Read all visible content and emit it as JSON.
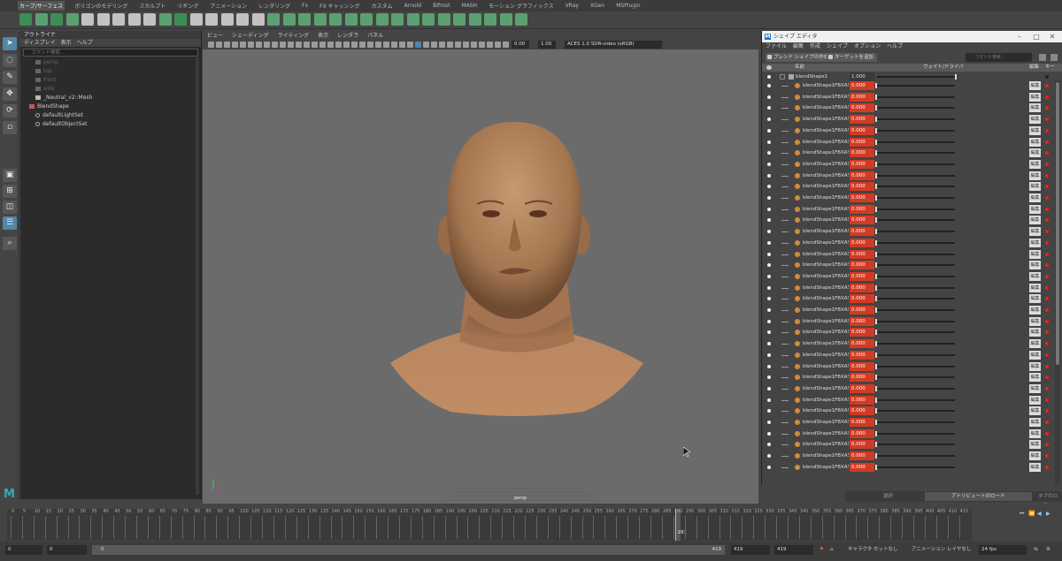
{
  "shelf": {
    "tabs": [
      "カーブ/サーフェス",
      "ポリゴンのモデリング",
      "スカルプト",
      "リギング",
      "アニメーション",
      "レンダリング",
      "Fx",
      "FX キャッシング",
      "カスタム",
      "Arnold",
      "Bifrost",
      "MASH",
      "モーション グラフィックス",
      "VRay",
      "XGen",
      "MSPlugin"
    ],
    "active_tab_index": 0
  },
  "outliner": {
    "title": "アウトライナ",
    "menu": [
      "ディスプレイ",
      "表示",
      "ヘルプ"
    ],
    "search_placeholder": "コマンド検索...",
    "items": [
      {
        "label": "persp",
        "dim": true,
        "icon": "camera-icon"
      },
      {
        "label": "top",
        "dim": true,
        "icon": "camera-icon"
      },
      {
        "label": "front",
        "dim": true,
        "icon": "camera-icon"
      },
      {
        "label": "side",
        "dim": true,
        "icon": "camera-icon"
      },
      {
        "label": "_Neutral_v2::Mesh",
        "dim": false,
        "icon": "mesh-icon"
      },
      {
        "label": "BlendShape",
        "dim": false,
        "icon": "blendshape-icon"
      },
      {
        "label": "defaultLightSet",
        "dim": false,
        "icon": "set-icon"
      },
      {
        "label": "defaultObjectSet",
        "dim": false,
        "icon": "set-icon"
      }
    ]
  },
  "viewport": {
    "menu": [
      "ビュー",
      "シェーディング",
      "ライティング",
      "表示",
      "レンダラ",
      "パネル"
    ],
    "field_a": "0.00",
    "field_b": "1.00",
    "color_space": "ACES 1.0 SDR-video (sRGB)",
    "camera_label": "persp"
  },
  "shape_editor": {
    "title": "シェイプ エディタ",
    "menu": [
      "ファイル",
      "編集",
      "作成",
      "シェイプ",
      "オプション",
      "ヘルプ"
    ],
    "btn_create_blend": "ブレンド シェイプの作成",
    "btn_add_target": "ターゲットを追加",
    "search_placeholder": "コマンド検索...",
    "col_name": "名前",
    "col_weight": "ウェイト/ドライバ",
    "col_edit": "編集",
    "col_key": "キー",
    "parent": {
      "name": "blendShape1",
      "value": "1.000"
    },
    "rows": [
      {
        "name": "blendShape1FBXASC",
        "value": "0.000"
      },
      {
        "name": "blendShape1FBXASC",
        "value": "0.000"
      },
      {
        "name": "blendShape1FBXASC",
        "value": "0.000"
      },
      {
        "name": "blendShape1FBXASC",
        "value": "0.000"
      },
      {
        "name": "blendShape1FBXASC",
        "value": "0.000"
      },
      {
        "name": "blendShape1FBXASC",
        "value": "0.000"
      },
      {
        "name": "blendShape1FBXASC",
        "value": "0.000"
      },
      {
        "name": "blendShape1FBXASC",
        "value": "0.000"
      },
      {
        "name": "blendShape1FBXASC",
        "value": "0.000"
      },
      {
        "name": "blendShape1FBXASC",
        "value": "0.000"
      },
      {
        "name": "blendShape1FBXASC",
        "value": "0.000"
      },
      {
        "name": "blendShape1FBXASC",
        "value": "0.000"
      },
      {
        "name": "blendShape1FBXASC",
        "value": "0.000"
      },
      {
        "name": "blendShape1FBXASC",
        "value": "0.000"
      },
      {
        "name": "blendShape1FBXASC",
        "value": "0.000"
      },
      {
        "name": "blendShape1FBXASC",
        "value": "0.000"
      },
      {
        "name": "blendShape1FBXASC",
        "value": "0.000"
      },
      {
        "name": "blendShape1FBXASC",
        "value": "0.000"
      },
      {
        "name": "blendShape1FBXASC",
        "value": "0.000"
      },
      {
        "name": "blendShape1FBXASC",
        "value": "0.000"
      },
      {
        "name": "blendShape1FBXASC",
        "value": "0.000"
      },
      {
        "name": "blendShape1FBXASC",
        "value": "0.000"
      },
      {
        "name": "blendShape1FBXASC",
        "value": "0.000"
      },
      {
        "name": "blendShape1FBXASC",
        "value": "0.000"
      },
      {
        "name": "blendShape1FBXASC",
        "value": "0.000"
      },
      {
        "name": "blendShape1FBXASC",
        "value": "0.000"
      },
      {
        "name": "blendShape1FBXASC",
        "value": "0.000"
      },
      {
        "name": "blendShape1FBXASC",
        "value": "0.000"
      },
      {
        "name": "blendShape1FBXASC",
        "value": "0.000"
      },
      {
        "name": "blendShape1FBXASC",
        "value": "0.000"
      },
      {
        "name": "blendShape1FBXASC",
        "value": "0.000"
      },
      {
        "name": "blendShape1FBXASC",
        "value": "0.000"
      },
      {
        "name": "blendShape1FBXASC",
        "value": "0.000"
      },
      {
        "name": "blendShape1FBXASC",
        "value": "0.000"
      },
      {
        "name": "blendShape1FBXASC",
        "value": "0.000"
      }
    ]
  },
  "channel_tabs": [
    "選択",
    "アトリビュートのロード",
    "タブのロード"
  ],
  "timeline": {
    "ticks": [
      0,
      5,
      10,
      15,
      20,
      25,
      30,
      35,
      40,
      45,
      50,
      55,
      60,
      65,
      70,
      75,
      80,
      85,
      90,
      95,
      100,
      105,
      110,
      115,
      120,
      125,
      130,
      135,
      140,
      145,
      150,
      155,
      160,
      165,
      170,
      175,
      180,
      185,
      190,
      195,
      200,
      205,
      210,
      215,
      220,
      225,
      230,
      235,
      240,
      245,
      250,
      255,
      260,
      265,
      270,
      275,
      280,
      285,
      290,
      295,
      300,
      305,
      310,
      315,
      320,
      325,
      330,
      335,
      340,
      345,
      350,
      355,
      360,
      365,
      370,
      375,
      380,
      385,
      390,
      395,
      400,
      405,
      410,
      415
    ],
    "current_frame": "291",
    "max_frame": 419
  },
  "range": {
    "start": "0",
    "anim_start": "0",
    "slider_start": "0",
    "slider_end": "419",
    "anim_end": "419",
    "end": "419",
    "char_set": "キャラクタ セットなし",
    "anim_layer": "アニメーション レイヤなし",
    "fps": "24 fps"
  },
  "colors": {
    "accent": "#5285a6",
    "key_red": "#e21f1f",
    "weight_red": "#d23a23",
    "maya_teal": "#37a8b8"
  }
}
